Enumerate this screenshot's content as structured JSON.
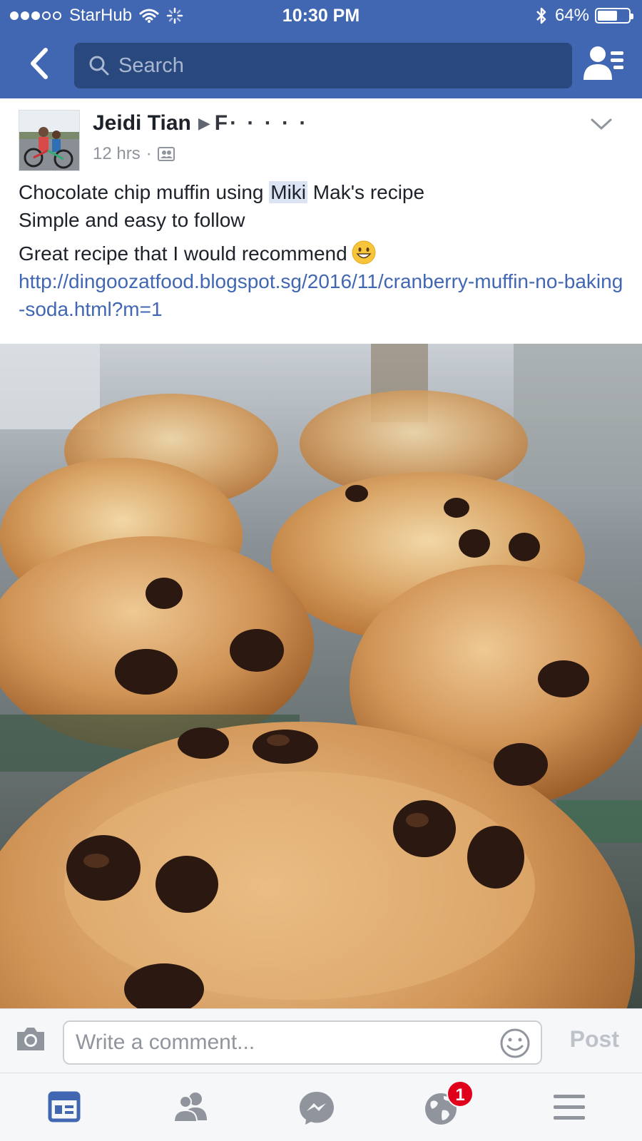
{
  "status_bar": {
    "carrier": "StarHub",
    "time": "10:30 PM",
    "battery_percent_label": "64%",
    "battery_level": 0.64,
    "signal_bars_filled": 3,
    "signal_bars_total": 5
  },
  "nav": {
    "search_placeholder": "Search"
  },
  "post": {
    "author": "Jeidi Tian",
    "target_group_partial": "F·  ·  ·  ·  ·",
    "time_ago": "12 hrs",
    "separator": "·",
    "lines": [
      "Simple and easy to follow",
      "Great recipe that I would recommend"
    ],
    "first_line_before": "Chocolate chip muffin using ",
    "first_line_mention": "Miki",
    "first_line_after": " Mak's recipe",
    "link": "http://dingoozatfood.blogspot.sg/2016/11/cranberry-muffin-no-baking-soda.html?m=1"
  },
  "comment_bar": {
    "placeholder": "Write a comment...",
    "post_label": "Post"
  },
  "tabbar": {
    "notifications_badge": "1"
  },
  "colors": {
    "brand_blue": "#4267b2",
    "search_bg": "#29487d",
    "link_blue": "#4267b2",
    "badge_red": "#e0001b"
  },
  "icons": {
    "back": "chevron-left-icon",
    "friends": "friend-requests-icon",
    "camera": "camera-icon",
    "emoji": "smiley-icon",
    "news_feed": "news-feed-icon",
    "friends_tab": "friends-icon",
    "messenger": "messenger-icon",
    "notifications": "globe-icon",
    "menu": "hamburger-menu-icon"
  }
}
